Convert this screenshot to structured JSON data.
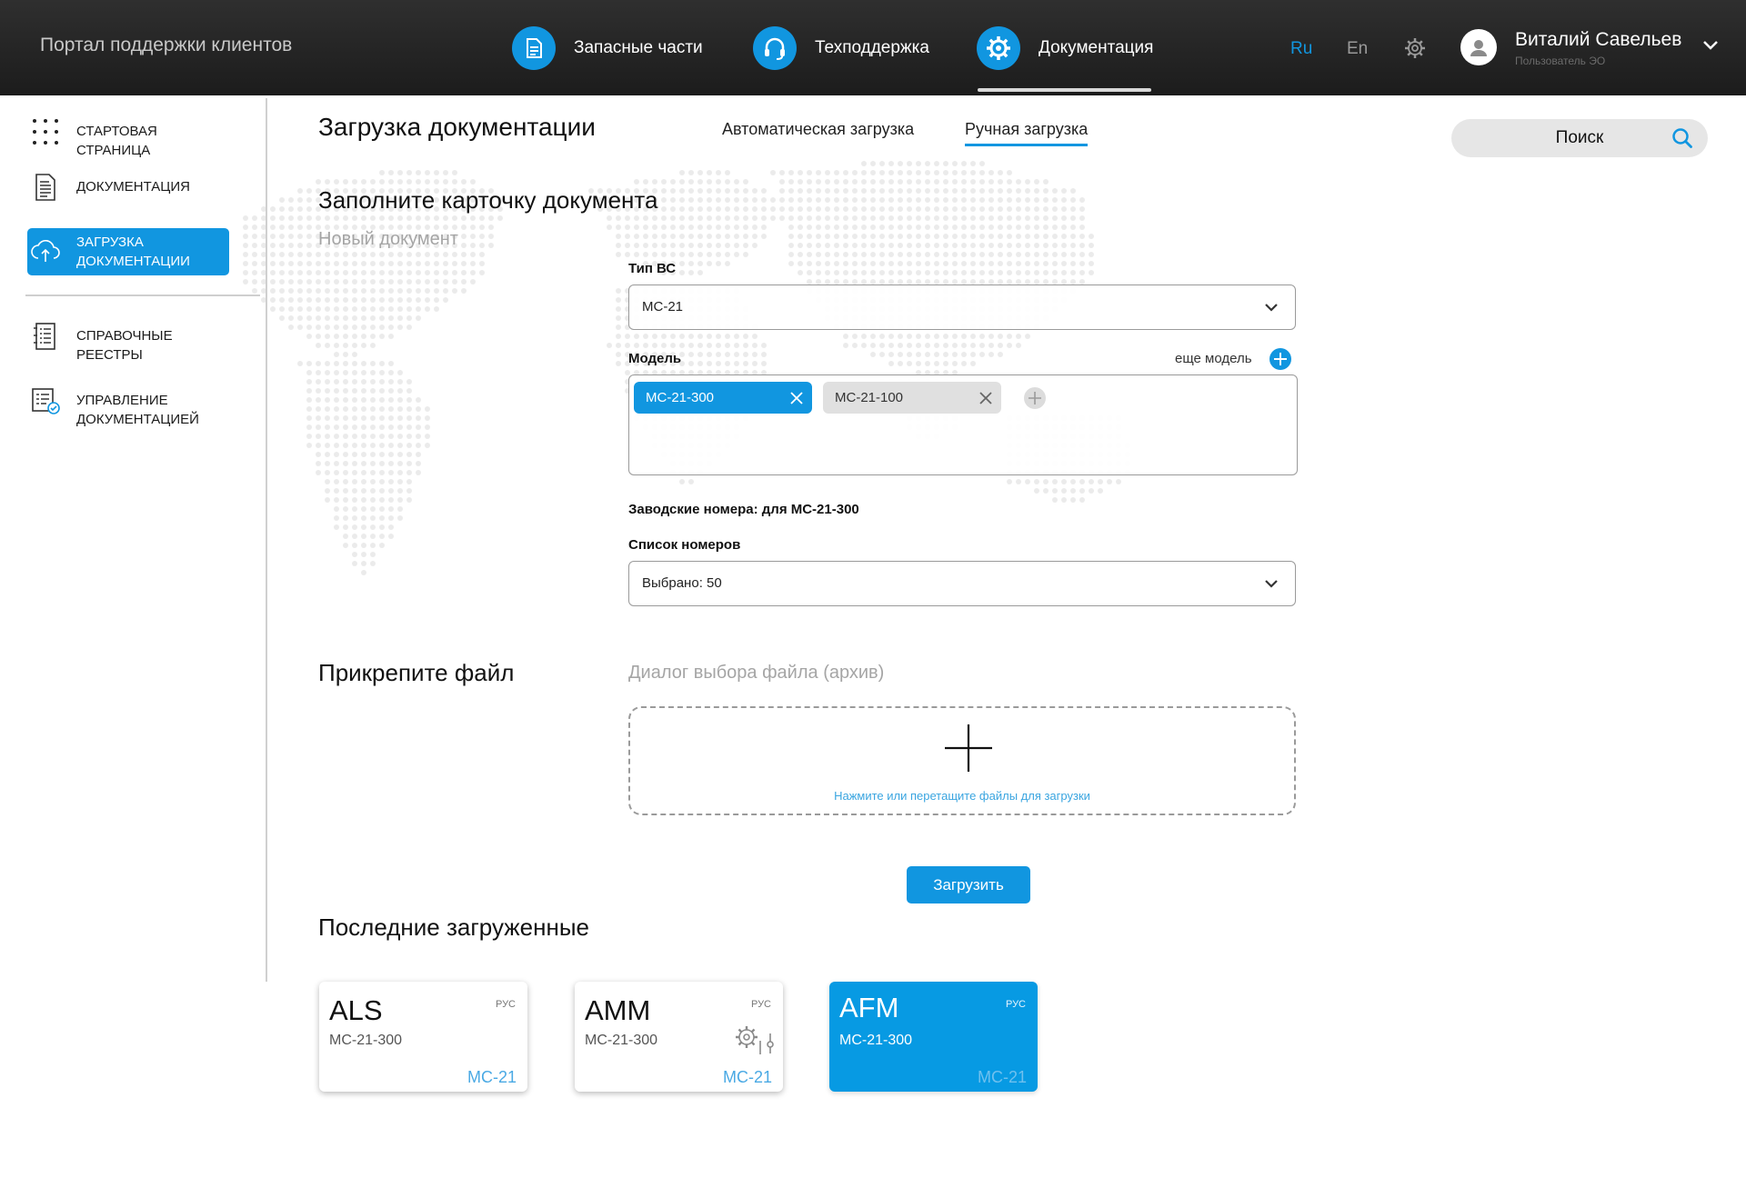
{
  "header": {
    "portal_title": "Портал поддержки клиентов",
    "nav": [
      {
        "label": "Запасные части",
        "icon": "document-icon"
      },
      {
        "label": "Техподдержка",
        "icon": "headset-icon"
      },
      {
        "label": "Документация",
        "icon": "gear-icon"
      }
    ],
    "active_nav": "Документация",
    "lang_ru": "Ru",
    "lang_en": "En",
    "user_name": "Виталий Савельев",
    "user_role": "Пользователь ЭО"
  },
  "sidebar": {
    "items": [
      {
        "label": "Стартовая страница",
        "icon": "dots-grid-icon"
      },
      {
        "label": "Документация",
        "icon": "document-icon"
      },
      {
        "label": "Загрузка документации",
        "icon": "cloud-upload-icon"
      },
      {
        "label": "Справочные реестры",
        "icon": "list-icon"
      },
      {
        "label": "Управление документацией",
        "icon": "checklist-icon"
      }
    ],
    "active": "Загрузка документации"
  },
  "main": {
    "title": "Загрузка документации",
    "tabs": [
      {
        "label": "Автоматическая загрузка"
      },
      {
        "label": "Ручная загрузка"
      }
    ],
    "active_tab": "Ручная загрузка",
    "search_label": "Поиск",
    "card_section_title": "Заполните карточку документа",
    "card_subtitle": "Новый документ",
    "vs_type_label": "Тип ВС",
    "vs_type_value": "MC-21",
    "model_label": "Модель",
    "more_model_label": "еще модель",
    "models": [
      {
        "label": "MC-21-300",
        "selected": true
      },
      {
        "label": "MC-21-100",
        "selected": false
      }
    ],
    "serials_heading": "Заводские номера: для MC-21-300",
    "serials_list_label": "Список номеров",
    "serials_value": "Выбрано: 50",
    "attach_title": "Прикрепите файл",
    "file_dialog_label": "Диалог выбора файла (архив)",
    "dropzone_hint": "Нажмите или перетащите файлы для загрузки",
    "upload_button": "Загрузить",
    "recent_title": "Последние загруженные",
    "recent_cards": [
      {
        "title": "ALS",
        "lang": "РУС",
        "model": "MC-21-300",
        "type": "MC-21",
        "active": false
      },
      {
        "title": "AMM",
        "lang": "РУС",
        "model": "MC-21-300",
        "type": "MC-21",
        "active": false
      },
      {
        "title": "AFM",
        "lang": "РУС",
        "model": "MC-21-300",
        "type": "MC-21",
        "active": true
      }
    ]
  },
  "colors": {
    "accent": "#1196e0",
    "topbar": "#262626"
  }
}
